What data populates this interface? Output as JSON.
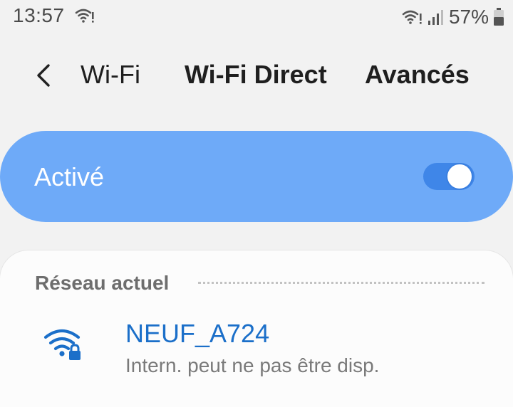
{
  "status_bar": {
    "time": "13:57",
    "battery_percent": "57%",
    "icons": [
      "wifi-alert-icon",
      "wifi-alert-icon",
      "signal-icon",
      "battery-icon"
    ]
  },
  "nav": {
    "back_icon": "chevron-left-icon",
    "tabs": [
      {
        "label": "Wi-Fi"
      },
      {
        "label": "Wi-Fi Direct"
      },
      {
        "label": "Avancés"
      }
    ]
  },
  "toggle": {
    "label": "Activé",
    "state": "on",
    "card_color": "#6eaaf8",
    "switch_color": "#3f86e8"
  },
  "current_network": {
    "section_title": "Réseau actuel",
    "name": "NEUF_A724",
    "status": "Intern. peut ne pas être disp.",
    "icon": "wifi-lock-icon",
    "accent": "#1b6fc9"
  }
}
